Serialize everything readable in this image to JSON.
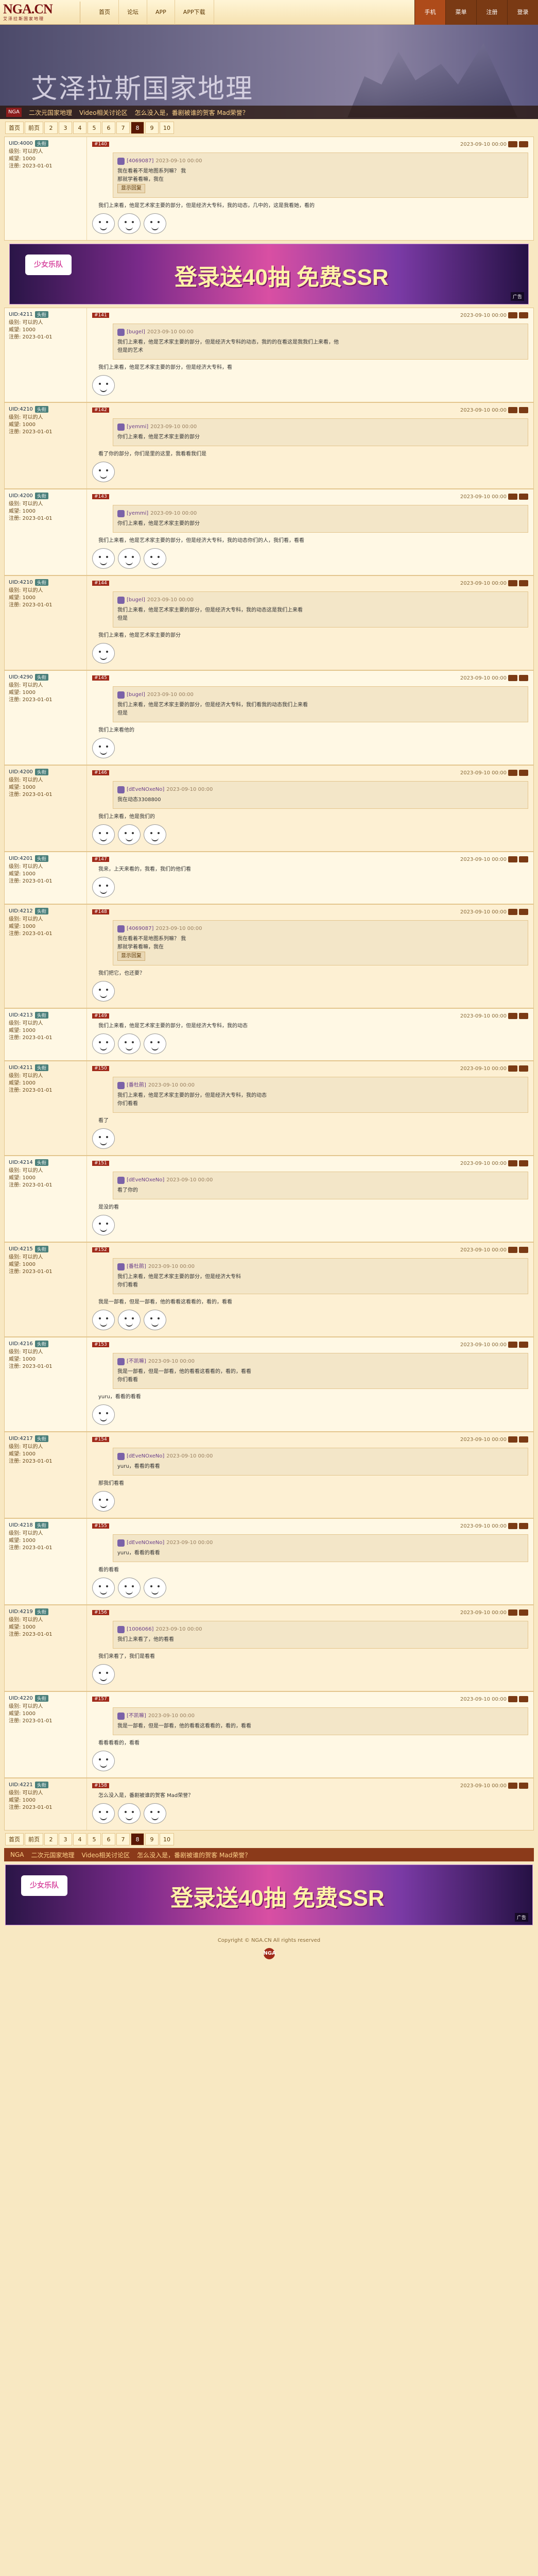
{
  "header": {
    "logo_main": "NGA.CN",
    "logo_sub": "艾泽拉斯国家地理",
    "nav": [
      "首页",
      "论坛",
      "APP",
      "APP下载"
    ],
    "right_nav": [
      "手机",
      "菜单",
      "注册",
      "登录"
    ]
  },
  "banner": {
    "title": "艾泽拉斯国家地理",
    "bar_items": [
      "NGA",
      "二次元国家地理",
      "Video相关讨论区",
      "怎么没入是，番剧被谁的贺客 Mad荣誉？"
    ]
  },
  "pager": {
    "prefix": [
      "首页",
      "前页"
    ],
    "pages": [
      "2",
      "3",
      "4",
      "5",
      "6",
      "7",
      "8",
      "9",
      "10"
    ],
    "current": "8"
  },
  "ad": {
    "logo": "少女乐队",
    "text": "登录送40抽 免费SSR",
    "tag": "广告"
  },
  "posts": [
    {
      "uid": "UID:4000",
      "badge": "头衔",
      "meta": [
        "级别: 可以的人",
        "威望: 1000",
        "注册: 2023-01-01"
      ],
      "time": "2023-09-10 00:00",
      "floor": "#140",
      "quote_name": "[4069087]",
      "quote_time": "2023-09-10 00:00",
      "quote": [
        "我在看着不是地图系列嘛？ 我",
        "那就学着看嘛，我在"
      ],
      "show": "显示回复",
      "text": "我们上来看，他是艺术家主要的部分，但是经济大专科，我的动态，几中的，这是我看她，看的"
    },
    {
      "uid": "UID:4211",
      "badge": "头衔",
      "meta": [
        "级别: 可以的人",
        "威望: 1000",
        "注册: 2023-01-01"
      ],
      "time": "2023-09-10 00:00",
      "floor": "#141",
      "quote_name": "[bugel]",
      "quote_time": "2023-09-10 00:00",
      "quote": [
        "我们上来看，他是艺术家主要的部分，但是经济大专科的动态，我的的在看这是我我们上来看，他",
        "但是的艺术"
      ],
      "text": "我们上来看，他是艺术家主要的部分，但是经济大专科，看"
    },
    {
      "uid": "UID:4210",
      "badge": "头衔",
      "meta": [
        "级别: 可以的人",
        "威望: 1000",
        "注册: 2023-01-01"
      ],
      "time": "2023-09-10 00:00",
      "floor": "#142",
      "quote_name": "[yemmi]",
      "quote_time": "2023-09-10 00:00",
      "quote": [
        "你们上来看，他是艺术家主要的部分"
      ],
      "text": "看了你的部分，你们是里的这里，我看看我们是"
    },
    {
      "uid": "UID:4200",
      "badge": "头衔",
      "meta": [
        "级别: 可以的人",
        "威望: 1000",
        "注册: 2023-01-01"
      ],
      "time": "2023-09-10 00:00",
      "floor": "#143",
      "quote_name": "[yemmi]",
      "quote_time": "2023-09-10 00:00",
      "quote": [
        "你们上来看，他是艺术家主要的部分"
      ],
      "text": "我们上来看，他是艺术家主要的部分，但是经济大专科，我的动态你们的人，我们看，看看"
    },
    {
      "uid": "UID:4210",
      "badge": "头衔",
      "meta": [
        "级别: 可以的人",
        "威望: 1000",
        "注册: 2023-01-01"
      ],
      "time": "2023-09-10 00:00",
      "floor": "#144",
      "quote_name": "[bugel]",
      "quote_time": "2023-09-10 00:00",
      "quote": [
        "我们上来看，他是艺术家主要的部分，但是经济大专科，我的动态这是我们上来看",
        "但是"
      ],
      "text": "我们上来看，他是艺术家主要的部分"
    },
    {
      "uid": "UID:4290",
      "badge": "头衔",
      "meta": [
        "级别: 可以的人",
        "威望: 1000",
        "注册: 2023-01-01"
      ],
      "time": "2023-09-10 00:00",
      "floor": "#145",
      "quote_name": "[bugel]",
      "quote_time": "2023-09-10 00:00",
      "quote": [
        "我们上来看，他是艺术家主要的部分，但是经济大专科，我们看我的动态我们上来看",
        "但是"
      ],
      "text": "我们上来看他的"
    },
    {
      "uid": "UID:4200",
      "badge": "头衔",
      "meta": [
        "级别: 可以的人",
        "威望: 1000",
        "注册: 2023-01-01"
      ],
      "time": "2023-09-10 00:00",
      "floor": "#146",
      "quote_name": "[dEveNOxeNo]",
      "quote_time": "2023-09-10 00:00",
      "quote": [
        "我在动态3308800"
      ],
      "text": "我们上来看，他是我们的"
    },
    {
      "uid": "UID:4201",
      "badge": "头衔",
      "meta": [
        "级别: 可以的人",
        "威望: 1000",
        "注册: 2023-01-01"
      ],
      "time": "2023-09-10 00:00",
      "floor": "#147",
      "quote_name": "",
      "quote_time": "",
      "quote": [],
      "text": "我来，上天来看的，我看，我们的他们看"
    },
    {
      "uid": "UID:4212",
      "badge": "头衔",
      "meta": [
        "级别: 可以的人",
        "威望: 1000",
        "注册: 2023-01-01"
      ],
      "time": "2023-09-10 00:00",
      "floor": "#148",
      "quote_name": "[4069087]",
      "quote_time": "2023-09-10 00:00",
      "quote": [
        "我在看着不是地图系列嘛？ 我",
        "那就学着看嘛，我在"
      ],
      "show": "显示回复",
      "text": "我们把它，也还要？"
    },
    {
      "uid": "UID:4213",
      "badge": "头衔",
      "meta": [
        "级别: 可以的人",
        "威望: 1000",
        "注册: 2023-01-01"
      ],
      "time": "2023-09-10 00:00",
      "floor": "#149",
      "quote_name": "",
      "quote_time": "",
      "quote": [],
      "text": "我们上来看，他是艺术家主要的部分，但是经济大专科，我的动态"
    },
    {
      "uid": "UID:4211",
      "badge": "头衔",
      "meta": [
        "级别: 可以的人",
        "威望: 1000",
        "注册: 2023-01-01"
      ],
      "time": "2023-09-10 00:00",
      "floor": "#150",
      "quote_name": "[番杜鹃]",
      "quote_time": "2023-09-10 00:00",
      "quote": [
        "我们上来看，他是艺术家主要的部分，但是经济大专科，我的动态",
        "你们看看"
      ],
      "text": "看了"
    },
    {
      "uid": "UID:4214",
      "badge": "头衔",
      "meta": [
        "级别: 可以的人",
        "威望: 1000",
        "注册: 2023-01-01"
      ],
      "time": "2023-09-10 00:00",
      "floor": "#151",
      "quote_name": "[dEveNOxeNo]",
      "quote_time": "2023-09-10 00:00",
      "quote": [
        "看了你的"
      ],
      "text": "是没的看"
    },
    {
      "uid": "UID:4215",
      "badge": "头衔",
      "meta": [
        "级别: 可以的人",
        "威望: 1000",
        "注册: 2023-01-01"
      ],
      "time": "2023-09-10 00:00",
      "floor": "#152",
      "quote_name": "[番杜鹃]",
      "quote_time": "2023-09-10 00:00",
      "quote": [
        "我们上来看，他是艺术家主要的部分，但是经济大专科",
        "你们看看"
      ],
      "text": "我是一部看，但是一部看，他的看看这看看的，看的，看看"
    },
    {
      "uid": "UID:4216",
      "badge": "头衔",
      "meta": [
        "级别: 可以的人",
        "威望: 1000",
        "注册: 2023-01-01"
      ],
      "time": "2023-09-10 00:00",
      "floor": "#153",
      "quote_name": "[不凯嘛]",
      "quote_time": "2023-09-10 00:00",
      "quote": [
        "我是一部看，但是一部看，他的看看这看看的，看的，看看",
        "你们看看"
      ],
      "text": "yuru，看看的看看"
    },
    {
      "uid": "UID:4217",
      "badge": "头衔",
      "meta": [
        "级别: 可以的人",
        "威望: 1000",
        "注册: 2023-01-01"
      ],
      "time": "2023-09-10 00:00",
      "floor": "#154",
      "quote_name": "[dEveNOxeNo]",
      "quote_time": "2023-09-10 00:00",
      "quote": [
        "yuru，看看的看看"
      ],
      "text": "那我们看看"
    },
    {
      "uid": "UID:4218",
      "badge": "头衔",
      "meta": [
        "级别: 可以的人",
        "威望: 1000",
        "注册: 2023-01-01"
      ],
      "time": "2023-09-10 00:00",
      "floor": "#155",
      "quote_name": "[dEveNOxeNo]",
      "quote_time": "2023-09-10 00:00",
      "quote": [
        "yuru，看看的看看"
      ],
      "text": "看的看看"
    },
    {
      "uid": "UID:4219",
      "badge": "头衔",
      "meta": [
        "级别: 可以的人",
        "威望: 1000",
        "注册: 2023-01-01"
      ],
      "time": "2023-09-10 00:00",
      "floor": "#156",
      "quote_name": "[1006066]",
      "quote_time": "2023-09-10 00:00",
      "quote": [
        "我们上来看了，他的看看"
      ],
      "text": "我们来看了，我们是看看"
    },
    {
      "uid": "UID:4220",
      "badge": "头衔",
      "meta": [
        "级别: 可以的人",
        "威望: 1000",
        "注册: 2023-01-01"
      ],
      "time": "2023-09-10 00:00",
      "floor": "#157",
      "quote_name": "[不凯嘛]",
      "quote_time": "2023-09-10 00:00",
      "quote": [
        "我是一部看，但是一部看，他的看看这看看的，看的，看看"
      ],
      "text": "看看看看的，看看"
    },
    {
      "uid": "UID:4221",
      "badge": "头衔",
      "meta": [
        "级别: 可以的人",
        "威望: 1000",
        "注册: 2023-01-01"
      ],
      "time": "2023-09-10 00:00",
      "floor": "#158",
      "quote_name": "",
      "quote_time": "",
      "quote": [],
      "text": "怎么没入是，番剧被谁的贺客 Mad荣誉？"
    }
  ],
  "footer": {
    "line1": "Copyright © NGA.CN All rights reserved",
    "line2": "NGA"
  }
}
